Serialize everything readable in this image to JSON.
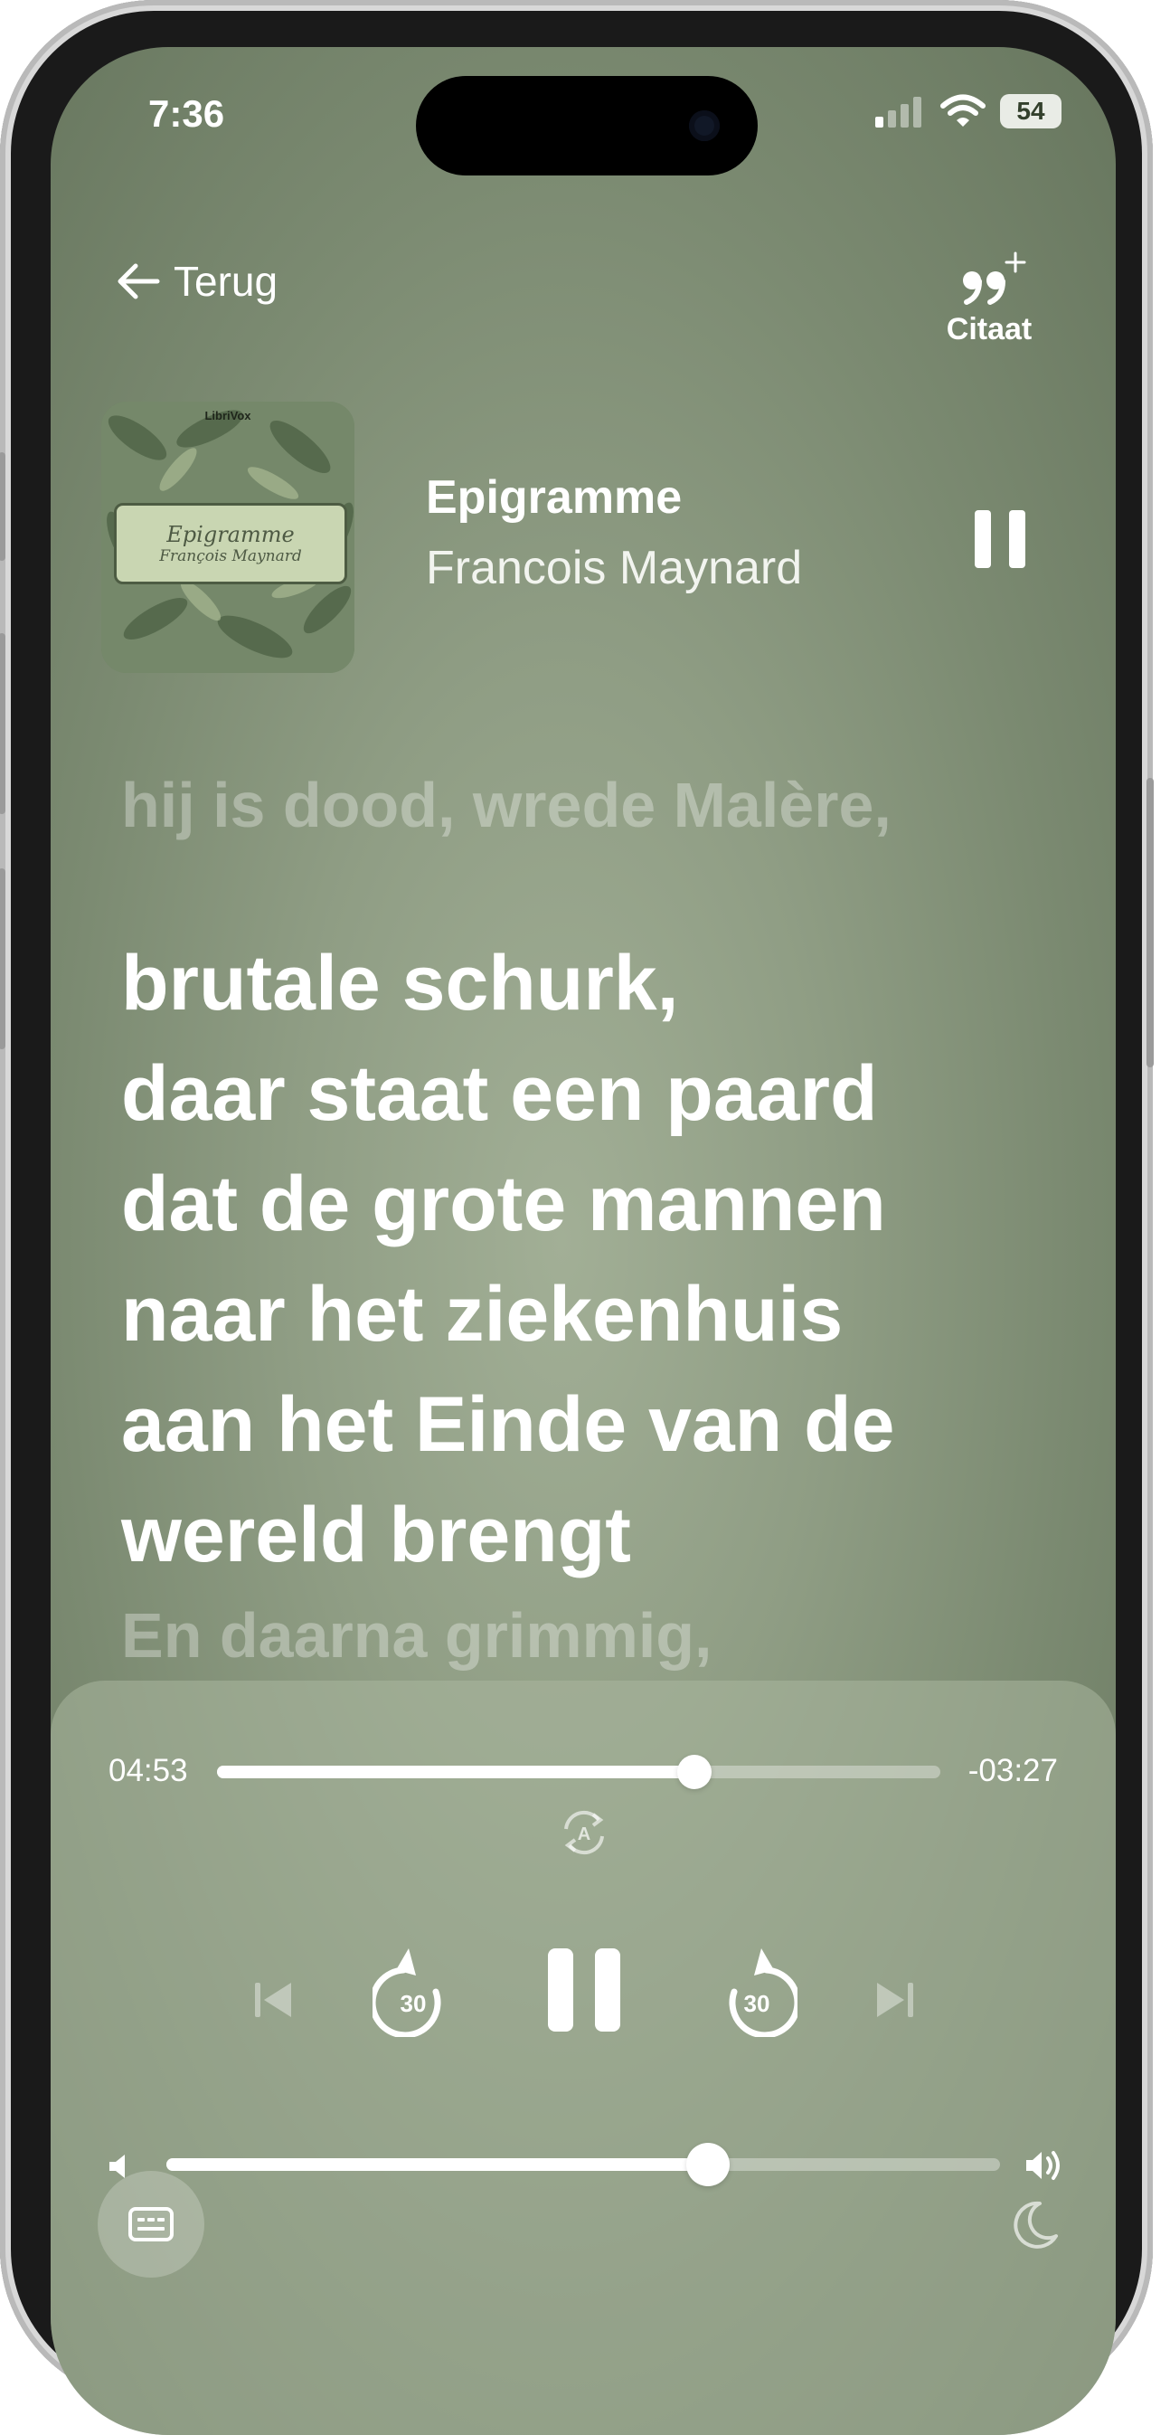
{
  "status": {
    "time": "7:36",
    "battery": "54"
  },
  "header": {
    "back_label": "Terug",
    "quote_label": "Citaat"
  },
  "book": {
    "title": "Epigramme",
    "author": "Francois Maynard",
    "cover": {
      "publisher": "LibriVox",
      "title": "Epigramme",
      "author": "François Maynard"
    }
  },
  "lyrics": {
    "previous": "hij is dood, wrede Malère,",
    "current": [
      "brutale schurk,",
      "daar staat een paard",
      "dat de grote mannen",
      "naar het ziekenhuis",
      "aan het Einde van de",
      "wereld brengt"
    ],
    "next": "En daarna grimmig,"
  },
  "player": {
    "elapsed": "04:53",
    "remaining": "-03:27",
    "progress": 0.66,
    "volume": 0.65,
    "skip_back_seconds": "30",
    "skip_forward_seconds": "30",
    "autoplay_badge": "A"
  }
}
